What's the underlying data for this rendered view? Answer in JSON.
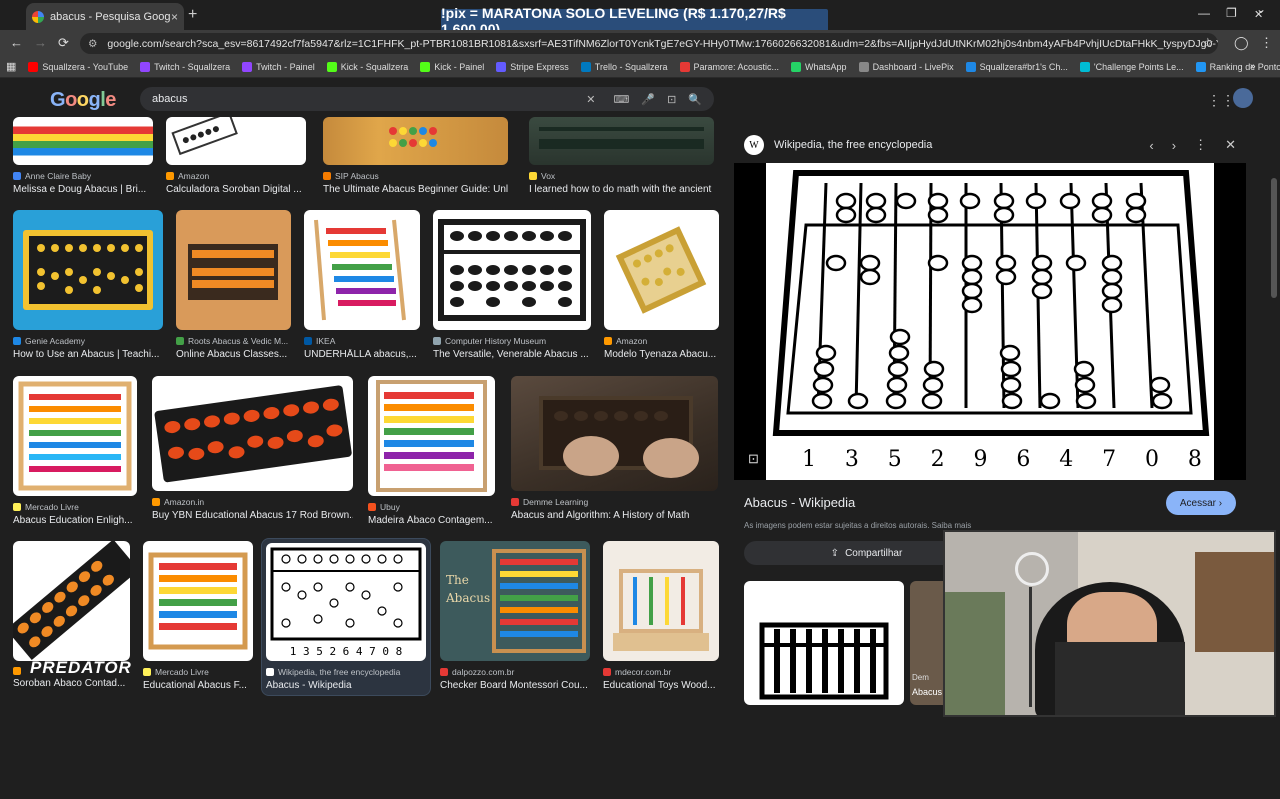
{
  "browser": {
    "tab_title": "abacus - Pesquisa Google",
    "tab_close": "×",
    "new_tab": "+",
    "url": "google.com/search?sca_esv=8617492cf7fa5947&rlz=1C1FHFK_pt-PTBR1081BR1081&sxsrf=AE3TifNM6ZlorT0YcnkTgE7eGY-HHy0TMw:1766026632081&udm=2&fbs=AIIjpHydJdUtNKrM02hj0s4nbm4yAFb4PvhjIUcDtaFHkK_tyspyDJg0-Y4Ji8bGEtEDNJF_QLt8mYL1Ky-...",
    "back": "←",
    "forward": "→",
    "reload": "⟳",
    "star": "☆",
    "profile": "◯",
    "menu": "⋮",
    "minimize": "—",
    "restore": "❐",
    "close": "✕"
  },
  "overlay_banner": "!pix = MARATONA SOLO LEVELING (R$ 1.170,27/R$ 1.600,00)",
  "bookmarks": [
    {
      "label": "Squallzera - YouTube",
      "color": "#ff0000"
    },
    {
      "label": "Twitch - Squallzera",
      "color": "#9146ff"
    },
    {
      "label": "Twitch - Painel",
      "color": "#9146ff"
    },
    {
      "label": "Kick - Squallzera",
      "color": "#53fc18"
    },
    {
      "label": "Kick - Painel",
      "color": "#53fc18"
    },
    {
      "label": "Stripe Express",
      "color": "#635bff"
    },
    {
      "label": "Trello - Squallzera",
      "color": "#0079bf"
    },
    {
      "label": "Paramore: Acoustic...",
      "color": "#e53935"
    },
    {
      "label": "WhatsApp",
      "color": "#25d366"
    },
    {
      "label": "Dashboard - LivePix",
      "color": "#888888"
    },
    {
      "label": "Squallzera#br1's Ch...",
      "color": "#1e88e5"
    },
    {
      "label": "'Challenge Points Le...",
      "color": "#00bcd4"
    },
    {
      "label": "Ranking de Pontos...",
      "color": "#2196f3"
    }
  ],
  "search": {
    "logo": "Google",
    "query": "abacus",
    "clear": "✕",
    "keyboard": "⌨",
    "mic": "🎤",
    "lens": "⊡",
    "submit": "🔍"
  },
  "results": [
    {
      "source": "Anne Claire Baby",
      "title": "Melissa e Doug Abacus | Bri...",
      "src_color": "#4285f4"
    },
    {
      "source": "Amazon",
      "title": "Calculadora Soroban Digital ...",
      "src_color": "#ff9900"
    },
    {
      "source": "SIP Abacus",
      "title": "The Ultimate Abacus Beginner Guide: Unl...",
      "src_color": "#f57c00"
    },
    {
      "source": "Vox",
      "title": "I learned how to do math with the ancient ...",
      "src_color": "#fdd835"
    },
    {
      "source": "Genie Academy",
      "title": "How to Use an Abacus | Teachi...",
      "src_color": "#1e88e5"
    },
    {
      "source": "Roots Abacus & Vedic M...",
      "title": "Online Abacus Classes...",
      "src_color": "#43a047"
    },
    {
      "source": "IKEA",
      "title": "UNDERHÅLLA abacus,...",
      "src_color": "#0058a3"
    },
    {
      "source": "Computer History Museum",
      "title": "The Versatile, Venerable Abacus ...",
      "src_color": "#90a4ae"
    },
    {
      "source": "Amazon",
      "title": "Modelo Tyenaza Abacu...",
      "src_color": "#ff9900"
    },
    {
      "source": "Mercado Livre",
      "title": "Abacus Education Enligh...",
      "src_color": "#fff159"
    },
    {
      "source": "Amazon.in",
      "title": "Buy YBN Educational Abacus 17 Rod Brown...",
      "src_color": "#ff9900"
    },
    {
      "source": "Ubuy",
      "title": "Madeira Ábaco Contagem...",
      "src_color": "#f4511e"
    },
    {
      "source": "Demme Learning",
      "title": "Abacus and Algorithm: A History of Math",
      "src_color": "#e53935"
    },
    {
      "source": "",
      "title": "Soroban Ábaco Contad...",
      "src_color": "#ff9900"
    },
    {
      "source": "Mercado Livre",
      "title": "Educational Abacus F...",
      "src_color": "#fff159"
    },
    {
      "source": "Wikipedia, the free encyclopedia",
      "title": "Abacus - Wikipedia",
      "src_color": "#ffffff"
    },
    {
      "source": "dalpozzo.com.br",
      "title": "Checker Board Montessori Cou...",
      "src_color": "#e53935"
    },
    {
      "source": "mdecor.com.br",
      "title": "Educational Toys Wood...",
      "src_color": "#e53935"
    }
  ],
  "thumb_texts": {
    "the_abacus": "The Abacus",
    "wiki_digits": "1 3 5 2 6 4 7 0 8"
  },
  "panel": {
    "site": "Wikipedia, the free encyclopedia",
    "site_logo": "W",
    "prev": "‹",
    "next": "›",
    "more": "⋮",
    "close": "✕",
    "image_digits": [
      "1",
      "3",
      "5",
      "2",
      "9",
      "6",
      "4",
      "7",
      "0",
      "8"
    ],
    "title": "Abacus - Wikipedia",
    "visit": "Acessar ›",
    "rights": "As imagens podem estar sujeitas a direitos autorais. Saiba mais",
    "share": "Compartilhar",
    "related_src": "Dem",
    "related_title": "Abacus"
  },
  "webcam_brand": "PREDATOR"
}
